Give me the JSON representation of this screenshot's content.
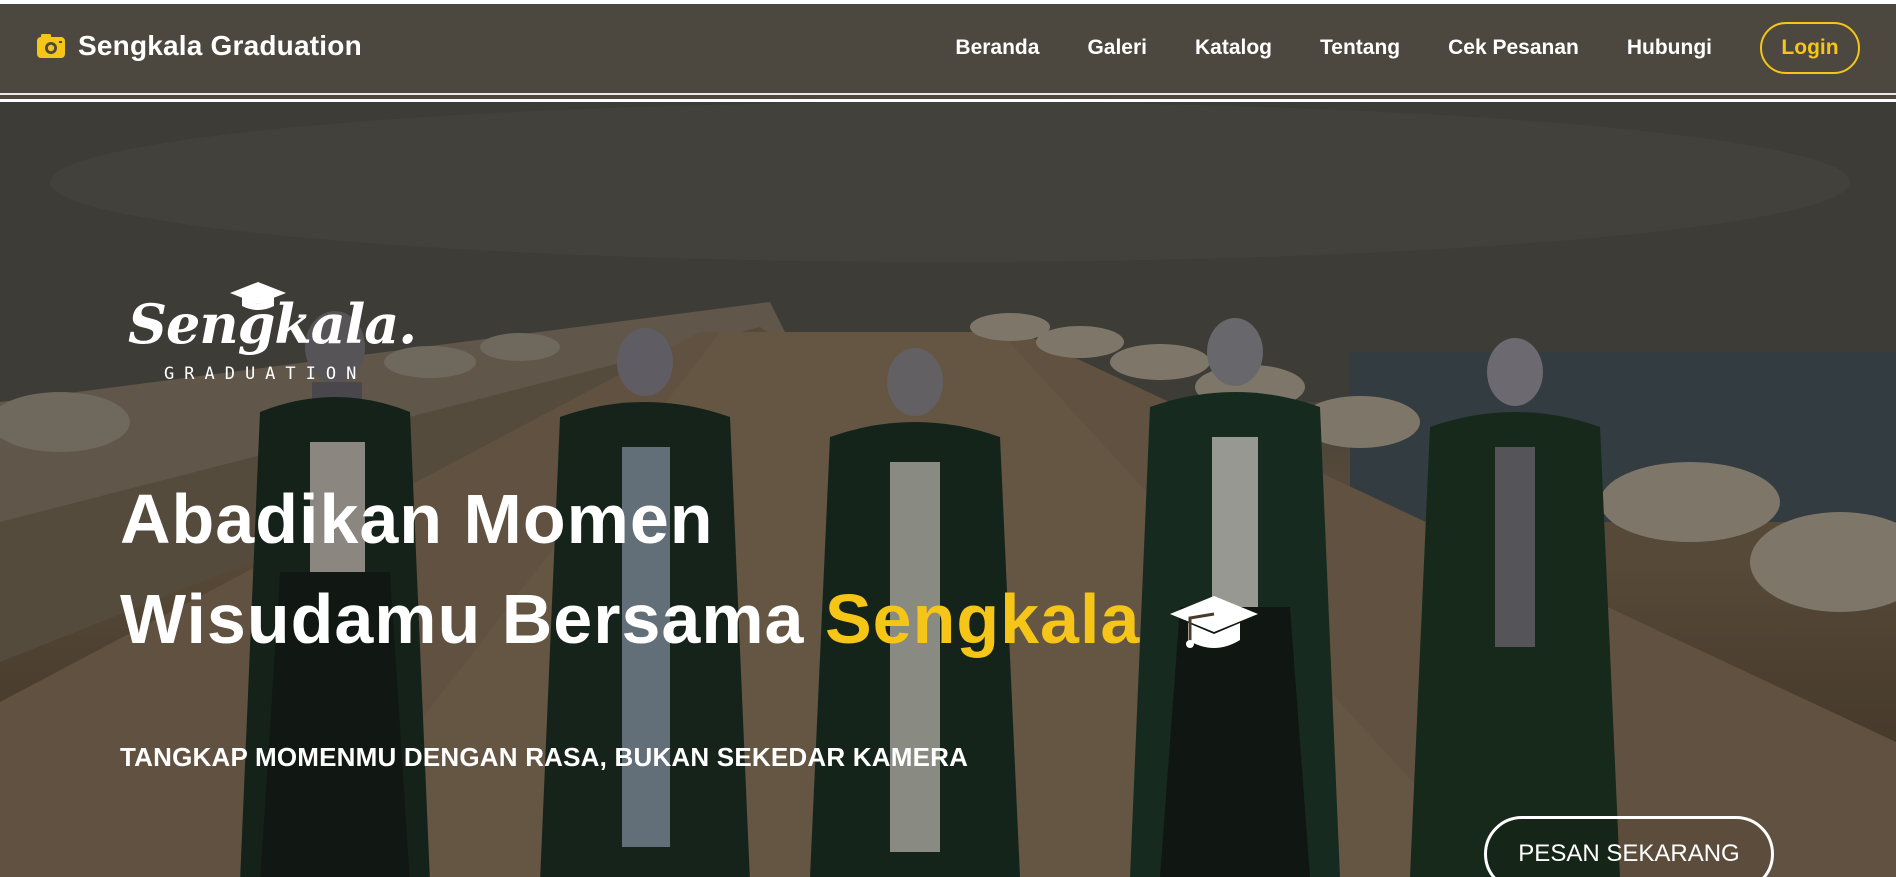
{
  "brand": {
    "icon": "camera-icon",
    "title": "Sengkala Graduation"
  },
  "nav": {
    "links": [
      "Beranda",
      "Galeri",
      "Katalog",
      "Tentang",
      "Cek Pesanan",
      "Hubungi"
    ],
    "login_label": "Login"
  },
  "hero": {
    "logo": {
      "wordmark": "Sengkala.",
      "tagline": "GRADUATION"
    },
    "headline_line1": "Abadikan Momen",
    "headline_line2_prefix": "Wisudamu Bersama",
    "headline_line2_accent": "Sengkala",
    "headline_icon": "graduation-cap-icon",
    "subheading": "TANGKAP MOMENMU DENGAN RASA, BUKAN SEKEDAR KAMERA",
    "cta_label": "PESAN SEKARANG"
  },
  "colors": {
    "nav_bg": "#4d483f",
    "accent": "#f5c518",
    "text": "#ffffff"
  }
}
